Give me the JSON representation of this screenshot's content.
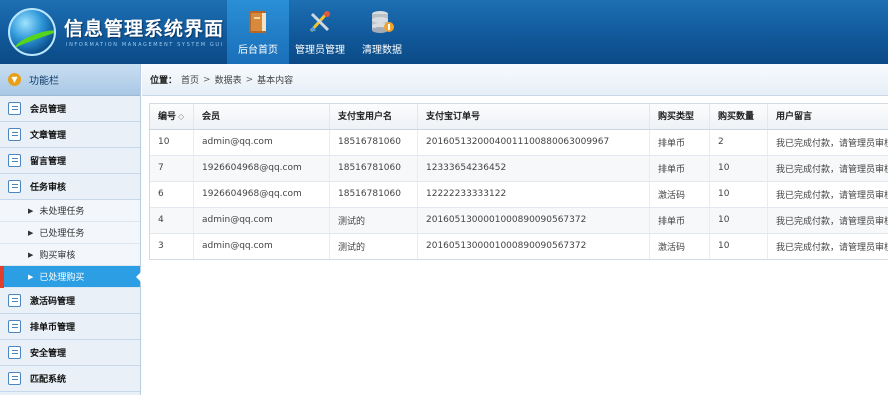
{
  "header": {
    "title": "信息管理系统界面",
    "subtitle": "INFORMATION MANAGEMENT SYSTEM GUI",
    "nav": [
      {
        "label": "后台首页",
        "icon": "book-icon",
        "active": true
      },
      {
        "label": "管理员管理",
        "icon": "tools-icon",
        "active": false
      },
      {
        "label": "清理数据",
        "icon": "database-icon",
        "active": false
      }
    ]
  },
  "sidebar": {
    "title": "功能栏",
    "items": [
      {
        "label": "会员管理"
      },
      {
        "label": "文章管理"
      },
      {
        "label": "留言管理"
      },
      {
        "label": "任务审核"
      },
      {
        "label": "激活码管理"
      },
      {
        "label": "排单币管理"
      },
      {
        "label": "安全管理"
      },
      {
        "label": "匹配系统"
      }
    ],
    "subitems": [
      {
        "label": "未处理任务"
      },
      {
        "label": "已处理任务"
      },
      {
        "label": "购买审核"
      },
      {
        "label": "已处理购买"
      }
    ]
  },
  "breadcrumb": {
    "label": "位置：",
    "items": [
      "首页",
      "数据表",
      "基本内容"
    ]
  },
  "table": {
    "columns": [
      "编号",
      "会员",
      "支付宝用户名",
      "支付宝订单号",
      "购买类型",
      "购买数量",
      "用户留言"
    ],
    "rows": [
      [
        "10",
        "admin@qq.com",
        "18516781060",
        "2016051320004001110088006300​9967",
        "排单币",
        "2",
        "我已完成付款，请管理员审核"
      ],
      [
        "7",
        "1926604968@qq.com",
        "18516781060",
        "12333654236452",
        "排单币",
        "10",
        "我已完成付款，请管理员审核"
      ],
      [
        "6",
        "1926604968@qq.com",
        "18516781060",
        "12222233333122",
        "激活码",
        "10",
        "我已完成付款，请管理员审核"
      ],
      [
        "4",
        "admin@qq.com",
        "测试的",
        "2016051300001000890090567372",
        "排单币",
        "10",
        "我已完成付款，请管理员审核"
      ],
      [
        "3",
        "admin@qq.com",
        "测试的",
        "2016051300001000890090567372",
        "激活码",
        "10",
        "我已完成付款，请管理员审核"
      ]
    ]
  }
}
